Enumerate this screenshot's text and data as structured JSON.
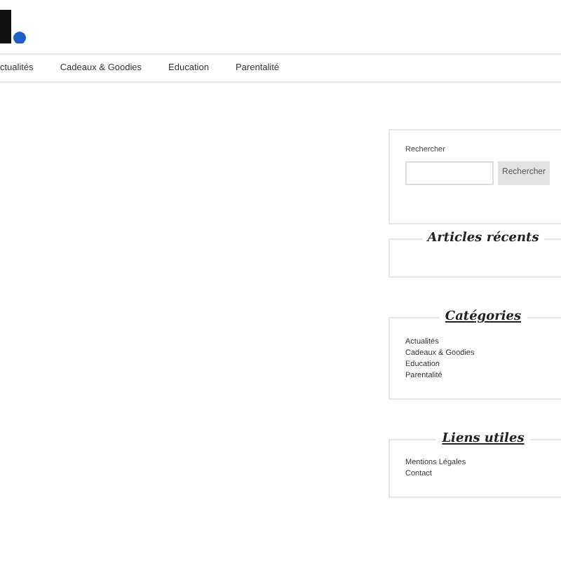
{
  "nav": {
    "items": [
      {
        "label": "ctualités"
      },
      {
        "label": "Cadeaux & Goodies"
      },
      {
        "label": "Education"
      },
      {
        "label": "Parentalité"
      }
    ]
  },
  "sidebar": {
    "search": {
      "label": "Rechercher",
      "button": "Rechercher"
    },
    "widgets": [
      {
        "title": "Articles récents",
        "linked": false
      },
      {
        "title": "Catégories",
        "linked": true,
        "items": [
          "Actualités",
          "Cadeaux & Goodies",
          "Education",
          "Parentalité"
        ]
      },
      {
        "title": "Liens utiles",
        "linked": true,
        "items": [
          "Mentions Légales",
          "Contact"
        ]
      }
    ]
  }
}
